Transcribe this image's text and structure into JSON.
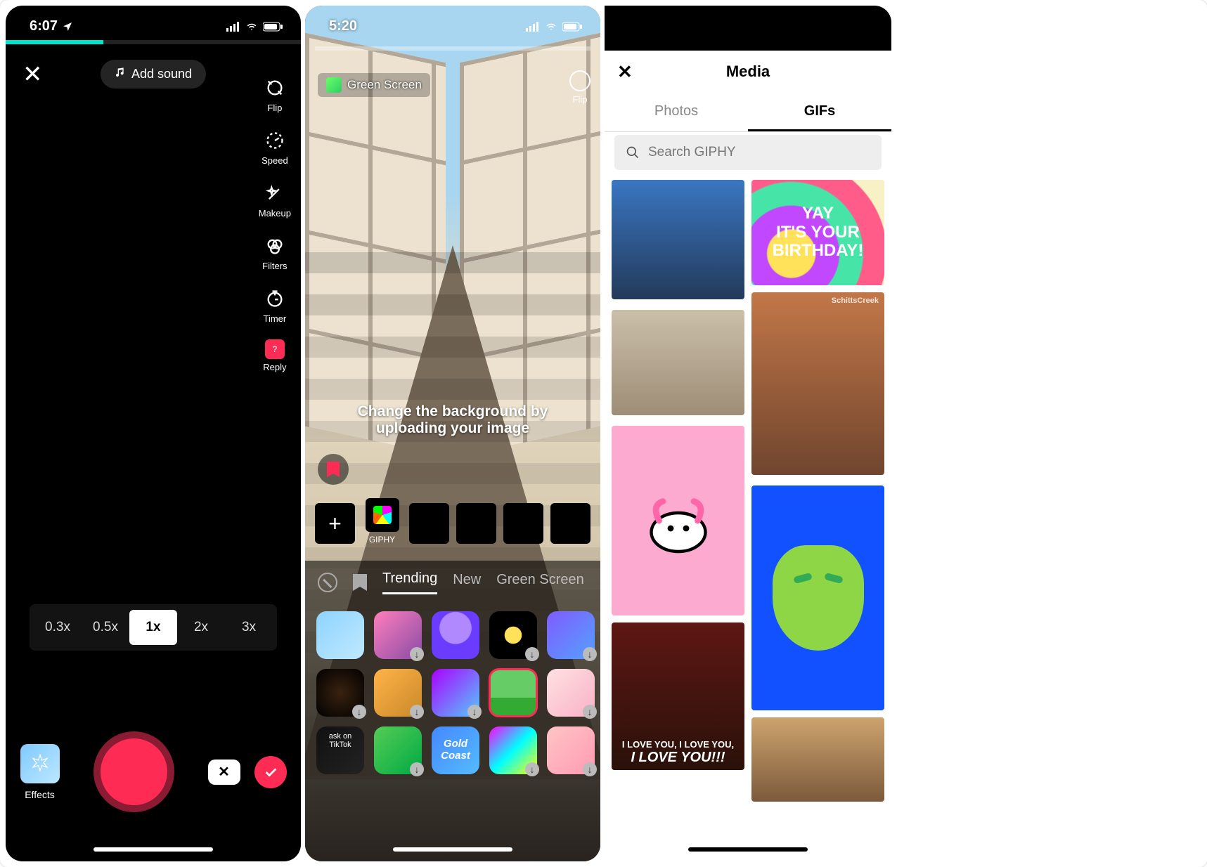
{
  "phone1": {
    "status_time": "6:07",
    "close_glyph": "✕",
    "add_sound_label": "Add sound",
    "side_tools": {
      "flip": "Flip",
      "speed": "Speed",
      "makeup": "Makeup",
      "filters": "Filters",
      "timer": "Timer",
      "reply": "Reply"
    },
    "speed_tabs": [
      "0.3x",
      "0.5x",
      "1x",
      "2x",
      "3x"
    ],
    "speed_selected_index": 2,
    "effects_label": "Effects",
    "undo_glyph": "✕",
    "done_glyph": "✓"
  },
  "phone2": {
    "status_time": "5:20",
    "green_screen_pill": "Green Screen",
    "flip_label": "Flip",
    "hint_text": "Change the background by uploading your image",
    "giphy_label": "GIPHY",
    "effect_tabs": {
      "trending": "Trending",
      "new": "New",
      "green": "Green Screen"
    },
    "ask_on_tiktok": "ask on\nTikTok",
    "gold_coast": "Gold\nCoast"
  },
  "phone3": {
    "title": "Media",
    "close_glyph": "✕",
    "tabs": {
      "photos": "Photos",
      "gifs": "GIFs"
    },
    "active_tab": "gifs",
    "search_placeholder": "Search GIPHY",
    "gifs": {
      "birthday_text": "YAY\nIT'S YOUR\nBIRTHDAY!",
      "schitts_tag": "SchittsCreek",
      "iloveyou_sub": "I LOVE YOU, I LOVE YOU,",
      "iloveyou_main": "I LOVE YOU!!!"
    }
  }
}
